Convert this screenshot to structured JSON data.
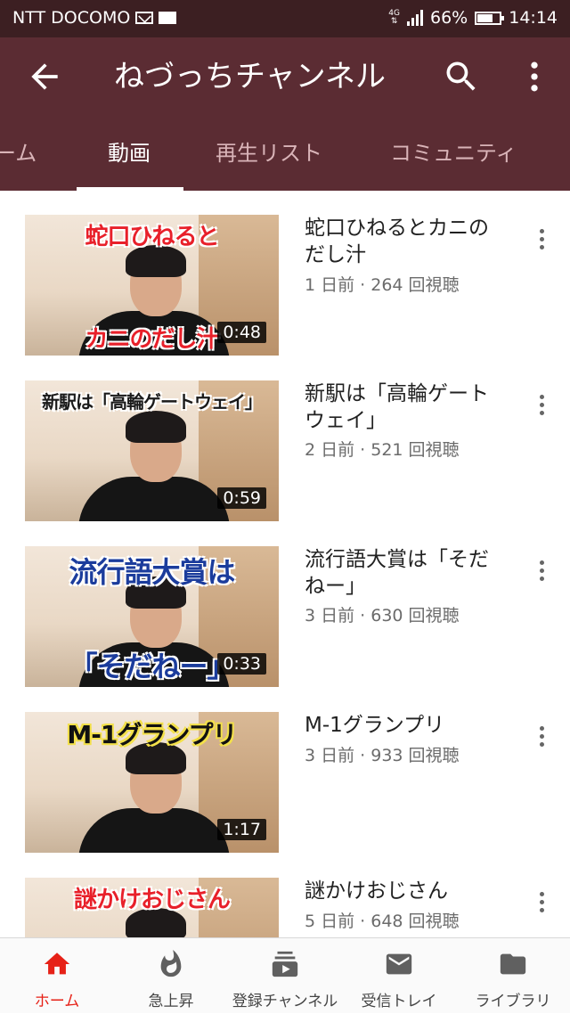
{
  "status_bar": {
    "carrier": "NTT DOCOMO",
    "network": "4G",
    "battery": "66%",
    "time": "14:14"
  },
  "app_bar": {
    "title": "ねづっちチャンネル",
    "icons": [
      "arrow-left-icon",
      "search-icon",
      "more-vert-icon"
    ]
  },
  "tabs": [
    {
      "label": "ーム",
      "active": false
    },
    {
      "label": "動画",
      "active": true
    },
    {
      "label": "再生リスト",
      "active": false
    },
    {
      "label": "コミュニティ",
      "active": false
    }
  ],
  "videos": [
    {
      "title_line1": "蛇口ひねるとカニの",
      "title_line2": "だし汁",
      "meta": "1 日前 · 264 回視聴",
      "duration": "0:48",
      "thumb_top": "蛇口ひねると",
      "thumb_bottom": "カニのだし汁"
    },
    {
      "title_line1": "新駅は「高輪ゲート",
      "title_line2": "ウェイ」",
      "meta": "2 日前 · 521 回視聴",
      "duration": "0:59",
      "thumb_top": "新駅は「高輪ゲートウェイ」",
      "thumb_bottom": ""
    },
    {
      "title_line1": "流行語大賞は「そだ",
      "title_line2": "ねー」",
      "meta": "3 日前 · 630 回視聴",
      "duration": "0:33",
      "thumb_top": "流行語大賞は",
      "thumb_bottom": "「そだねー」"
    },
    {
      "title_line1": "M-1グランプリ",
      "title_line2": "",
      "meta": "3 日前 · 933 回視聴",
      "duration": "1:17",
      "thumb_top": "M-1グランプリ",
      "thumb_bottom": ""
    },
    {
      "title_line1": "謎かけおじさん",
      "title_line2": "",
      "meta": "5 日前 · 648 回視聴",
      "duration": "",
      "thumb_top": "謎かけおじさん",
      "thumb_bottom": ""
    }
  ],
  "bottom_nav": [
    {
      "label": "ホーム",
      "icon": "home-icon",
      "active": true
    },
    {
      "label": "急上昇",
      "icon": "flame-icon",
      "active": false
    },
    {
      "label": "登録チャンネル",
      "icon": "subscriptions-icon",
      "active": false
    },
    {
      "label": "受信トレイ",
      "icon": "inbox-icon",
      "active": false
    },
    {
      "label": "ライブラリ",
      "icon": "folder-icon",
      "active": false
    }
  ],
  "colors": {
    "status_bar": "#3c1f22",
    "app_bar": "#5b2c33",
    "active_nav": "#e62117"
  }
}
